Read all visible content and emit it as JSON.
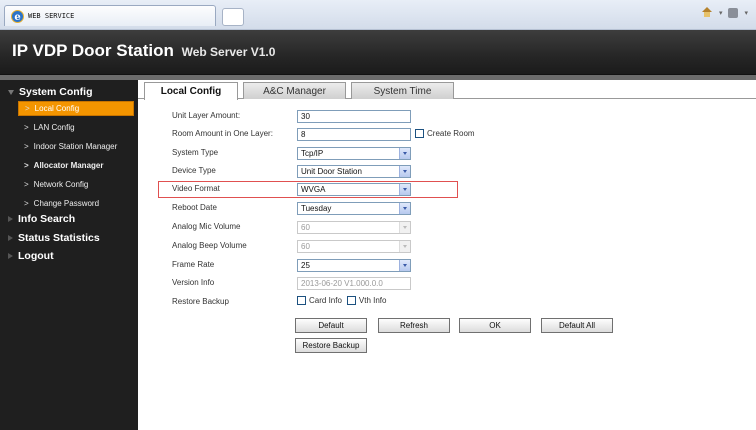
{
  "browser": {
    "tab_title": "WEB SERVICE"
  },
  "header": {
    "title": "IP VDP Door Station",
    "subtitle": "Web Server V1.0"
  },
  "sidebar": {
    "groups": [
      {
        "label": "System Config"
      },
      {
        "label": "Info Search"
      },
      {
        "label": "Status Statistics"
      },
      {
        "label": "Logout"
      }
    ],
    "items": [
      {
        "label": "Local Config"
      },
      {
        "label": "LAN Config"
      },
      {
        "label": "Indoor Station Manager"
      },
      {
        "label": "Allocator Manager"
      },
      {
        "label": "Network Config"
      },
      {
        "label": "Change Password"
      }
    ]
  },
  "tabs": [
    {
      "label": "Local Config"
    },
    {
      "label": "A&C Manager"
    },
    {
      "label": "System Time"
    }
  ],
  "form": {
    "unit_layer_amount": {
      "label": "Unit Layer Amount:",
      "value": "30"
    },
    "room_amount": {
      "label": "Room Amount in One Layer:",
      "value": "8",
      "checkbox_label": "Create Room"
    },
    "system_type": {
      "label": "System Type",
      "value": "Tcp/IP"
    },
    "device_type": {
      "label": "Device Type",
      "value": "Unit Door Station"
    },
    "video_format": {
      "label": "Video Format",
      "value": "WVGA"
    },
    "reboot_date": {
      "label": "Reboot Date",
      "value": "Tuesday"
    },
    "analog_mic_volume": {
      "label": "Analog Mic Volume",
      "value": "60"
    },
    "analog_beep_volume": {
      "label": "Analog Beep Volume",
      "value": "60"
    },
    "frame_rate": {
      "label": "Frame Rate",
      "value": "25"
    },
    "version_info": {
      "label": "Version Info",
      "value": "2013-06-20 V1.000.0.0"
    },
    "restore_backup": {
      "label": "Restore Backup",
      "card_info": "Card Info",
      "vth_info": "Vth Info"
    }
  },
  "buttons": {
    "default": "Default",
    "refresh": "Refresh",
    "ok": "OK",
    "default_all": "Default All",
    "restore_backup": "Restore Backup"
  },
  "colors": {
    "accent": "#f49500",
    "sidebar_bg": "#1f1f1f",
    "highlight_box": "#e05050"
  }
}
